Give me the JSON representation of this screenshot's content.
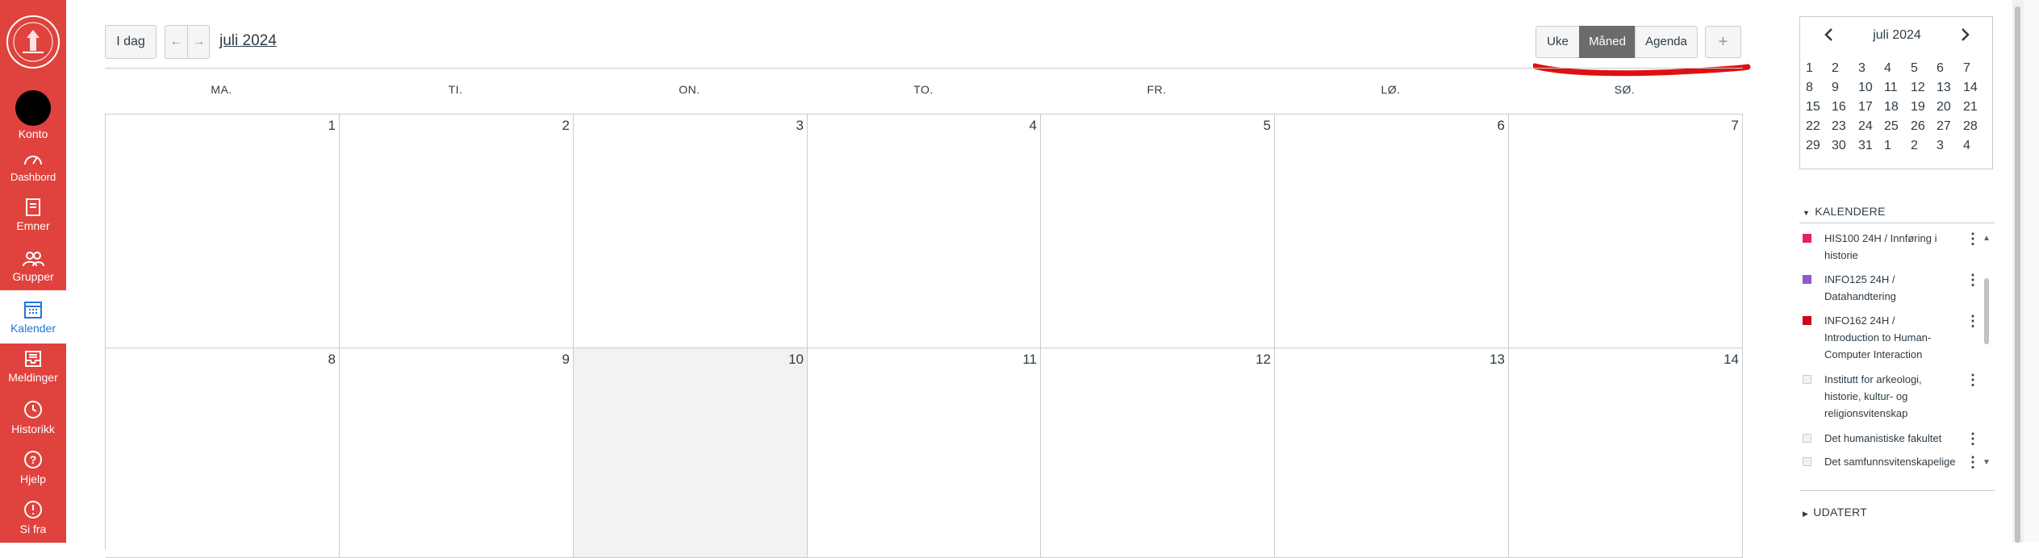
{
  "nav": {
    "items": [
      {
        "label": "Konto",
        "icon": "account-avatar"
      },
      {
        "label": "Dashbord",
        "icon": "dashboard-gauge-icon"
      },
      {
        "label": "Emner",
        "icon": "courses-book-icon"
      },
      {
        "label": "Grupper",
        "icon": "groups-icon"
      },
      {
        "label": "Kalender",
        "icon": "calendar-icon"
      },
      {
        "label": "Meldinger",
        "icon": "inbox-icon"
      },
      {
        "label": "Historikk",
        "icon": "clock-icon"
      },
      {
        "label": "Hjelp",
        "icon": "help-icon"
      },
      {
        "label": "Si fra",
        "icon": "alert-icon"
      }
    ],
    "active": "Kalender",
    "color": "#e0423d"
  },
  "toolbar": {
    "today": "I dag",
    "prev": "←",
    "next": "→",
    "title": "juli 2024",
    "views": [
      "Uke",
      "Måned",
      "Agenda"
    ],
    "active_view": "Måned",
    "add": "+"
  },
  "grid": {
    "weekdays": [
      "MA.",
      "TI.",
      "ON.",
      "TO.",
      "FR.",
      "LØ.",
      "SØ."
    ],
    "weeks": [
      [
        "1",
        "2",
        "3",
        "4",
        "5",
        "6",
        "7"
      ],
      [
        "8",
        "9",
        "10",
        "11",
        "12",
        "13",
        "14"
      ]
    ],
    "today": "10"
  },
  "mini_calendar": {
    "title": "juli 2024",
    "prev": "<",
    "next": ">",
    "weeks": [
      [
        "1",
        "2",
        "3",
        "4",
        "5",
        "6",
        "7"
      ],
      [
        "8",
        "9",
        "10",
        "11",
        "12",
        "13",
        "14"
      ],
      [
        "15",
        "16",
        "17",
        "18",
        "19",
        "20",
        "21"
      ],
      [
        "22",
        "23",
        "24",
        "25",
        "26",
        "27",
        "28"
      ],
      [
        "29",
        "30",
        "31",
        "1",
        "2",
        "3",
        "4"
      ]
    ]
  },
  "calendars": {
    "title": "KALENDERE",
    "items": [
      {
        "lines": [
          "HIS100 24H / Innføring i",
          "historie"
        ],
        "color": "#e0245e"
      },
      {
        "lines": [
          "INFO125 24H /",
          "Datahandtering"
        ],
        "color": "#8e5cc9"
      },
      {
        "lines": [
          "INFO162 24H /",
          "Introduction to Human-",
          "Computer Interaction"
        ],
        "color": "#d0021b"
      },
      {
        "lines": [
          "Institutt for arkeologi,",
          "historie, kultur- og",
          "religionsvitenskap"
        ],
        "color": "#dcdcdc"
      },
      {
        "lines": [
          "Det humanistiske fakultet"
        ],
        "color": "#dcdcdc"
      },
      {
        "lines": [
          "Det samfunnsvitenskapelige"
        ],
        "color": "#dcdcdc"
      }
    ]
  },
  "undated": {
    "title": "UDATERT"
  }
}
